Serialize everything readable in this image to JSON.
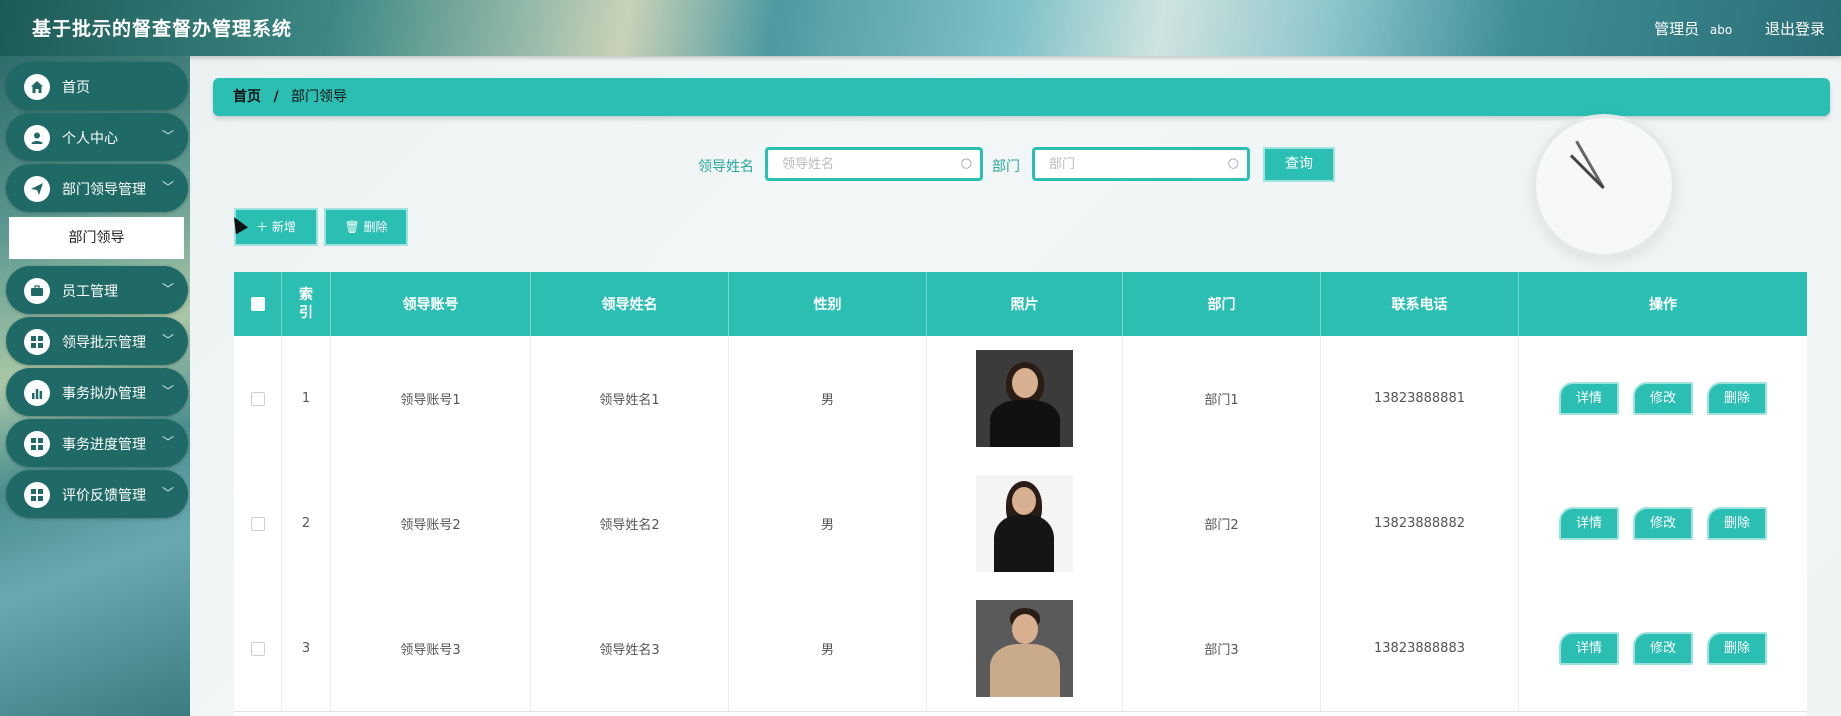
{
  "header": {
    "app_title": "基于批示的督查督办管理系统",
    "role_label": "管理员",
    "user_name": "abo",
    "logout_label": "退出登录"
  },
  "sidebar": {
    "items": [
      {
        "label": "首页",
        "icon": "home-icon",
        "has_arrow": false
      },
      {
        "label": "个人中心",
        "icon": "user-icon",
        "has_arrow": true
      },
      {
        "label": "部门领导管理",
        "icon": "paper-plane-icon",
        "has_arrow": true
      },
      {
        "label": "员工管理",
        "icon": "briefcase-icon",
        "has_arrow": true
      },
      {
        "label": "领导批示管理",
        "icon": "grid-icon",
        "has_arrow": true
      },
      {
        "label": "事务拟办管理",
        "icon": "bar-chart-icon",
        "has_arrow": true
      },
      {
        "label": "事务进度管理",
        "icon": "grid-icon",
        "has_arrow": true
      },
      {
        "label": "评价反馈管理",
        "icon": "grid-icon",
        "has_arrow": true
      }
    ],
    "active_submenu": "部门领导"
  },
  "breadcrumb": {
    "home": "首页",
    "separator": "/",
    "current": "部门领导"
  },
  "search": {
    "name_label": "领导姓名",
    "name_placeholder": "领导姓名",
    "dept_label": "部门",
    "dept_placeholder": "部门",
    "query_button": "查询"
  },
  "actions": {
    "add_button": "＋ 新增",
    "delete_button": "🗑 删除"
  },
  "table": {
    "columns": [
      "索引",
      "领导账号",
      "领导姓名",
      "性别",
      "照片",
      "部门",
      "联系电话",
      "操作"
    ],
    "index_header_chars": [
      "索",
      "引"
    ],
    "rows": [
      {
        "index": "1",
        "account": "领导账号1",
        "name": "领导姓名1",
        "gender": "男",
        "dept": "部门1",
        "phone": "13823888881"
      },
      {
        "index": "2",
        "account": "领导账号2",
        "name": "领导姓名2",
        "gender": "男",
        "dept": "部门2",
        "phone": "13823888882"
      },
      {
        "index": "3",
        "account": "领导账号3",
        "name": "领导姓名3",
        "gender": "男",
        "dept": "部门3",
        "phone": "13823888883"
      }
    ],
    "row_buttons": {
      "detail": "详情",
      "edit": "修改",
      "delete": "删除"
    }
  },
  "colors": {
    "accent": "#2bbfb4",
    "sidebar_item": "#1f6a66"
  }
}
